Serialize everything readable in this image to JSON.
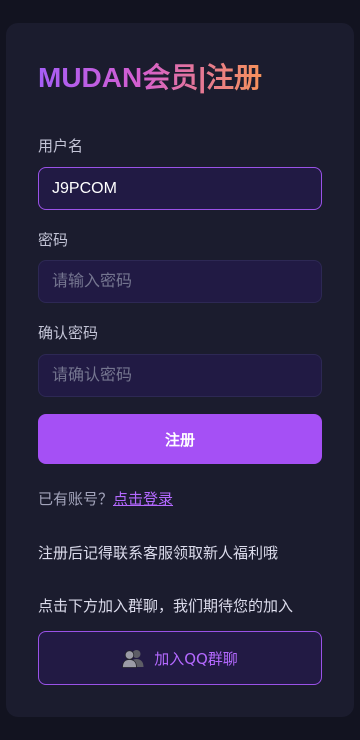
{
  "header": {
    "title": "MUDAN会员|注册"
  },
  "form": {
    "username_label": "用户名",
    "username_value": "J9PCOM",
    "password_label": "密码",
    "password_placeholder": "请输入密码",
    "confirm_label": "确认密码",
    "confirm_placeholder": "请确认密码",
    "submit_label": "注册"
  },
  "login": {
    "prompt": "已有账号？",
    "link_label": "点击登录"
  },
  "notes": {
    "welfare": "注册后记得联系客服领取新人福利哦",
    "group": "点击下方加入群聊，我们期待您的加入"
  },
  "qq_group": {
    "label": "加入QQ群聊",
    "icon": "group-users-icon"
  },
  "colors": {
    "accent": "#a550f5",
    "link": "#b469ff",
    "card_background": "#1b1c2e",
    "page_background": "#121320",
    "input_background": "#211a44",
    "title_gradient_start": "#a55ef7",
    "title_gradient_end": "#f6925a"
  }
}
